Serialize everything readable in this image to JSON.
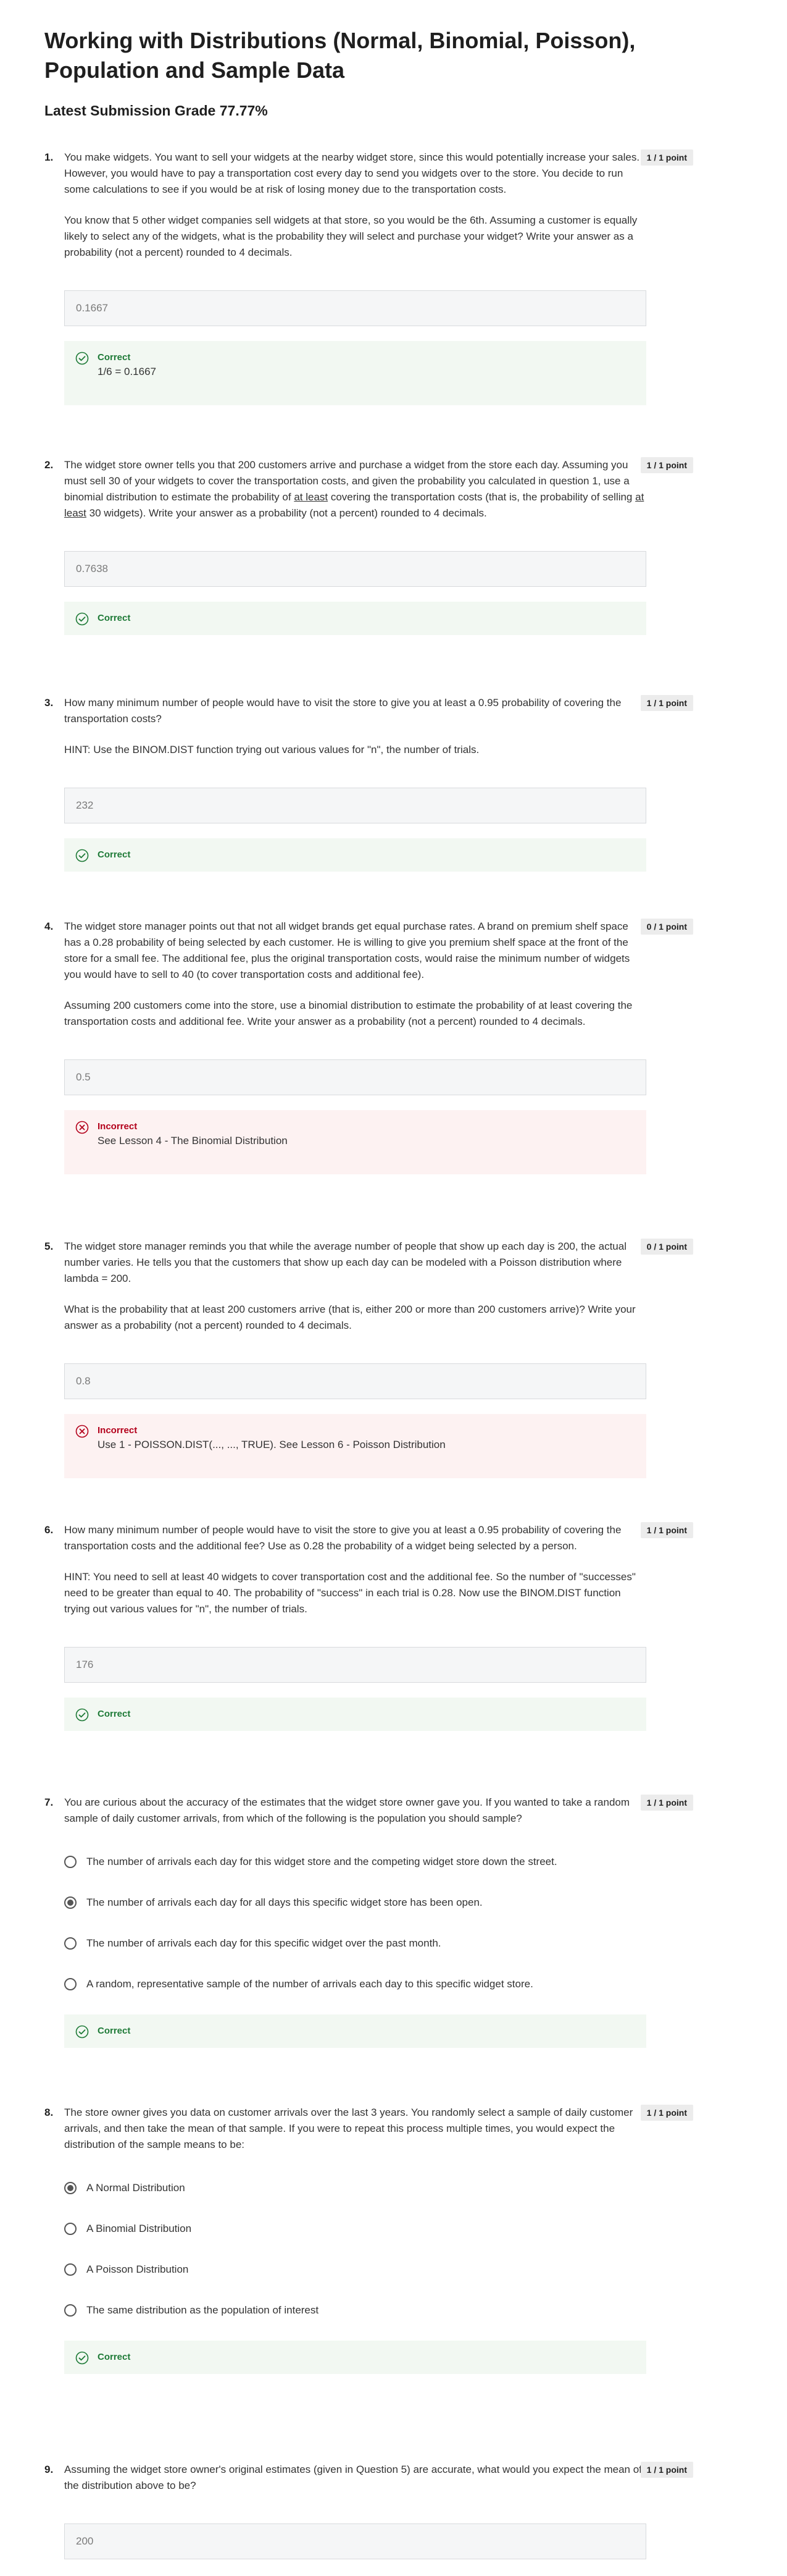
{
  "page": {
    "title": "Working with Distributions (Normal, Binomial, Poisson), Population and Sample Data",
    "grade_label": "Latest Submission Grade 77.77%"
  },
  "colors": {
    "correct": "#1e7a37",
    "incorrect": "#b3001b",
    "badge": "#ececec"
  },
  "icons": {
    "correct": "check-circle-icon",
    "incorrect": "x-circle-icon",
    "radio": "radio-button"
  },
  "questions": [
    {
      "num": "1.",
      "points": "1 / 1 point",
      "paragraphs": [
        "You make widgets.  You want to sell your widgets at the nearby widget store, since this would potentially increase your sales.  However, you would have to pay a transportation cost every day to send you widgets over to the store. You decide to run some calculations to see if you would be at risk of losing money due to the transportation costs.",
        "You know that 5 other widget companies sell widgets at that store, so you would be the 6th. Assuming a customer is equally likely to select any of the widgets, what is the probability they will select and purchase your widget? Write your answer as a probability (not a percent) rounded to 4 decimals."
      ],
      "answer": "0.1667",
      "feedback": {
        "status": "Correct",
        "explanation": "1/6 = 0.1667"
      }
    },
    {
      "num": "2.",
      "points": "1 / 1 point",
      "paragraphs": [
        "The widget store owner tells you that 200 customers arrive and purchase a widget from the store each day. Assuming you must sell 30 of your widgets to cover the transportation costs, and given the probability you calculated in question 1, use a binomial distribution to estimate the probability of at least covering the transportation costs (that is, the probability of selling at least 30 widgets). Write your answer as a probability (not a percent) rounded to 4 decimals."
      ],
      "answer": "0.7638",
      "feedback": {
        "status": "Correct",
        "explanation": ""
      }
    },
    {
      "num": "3.",
      "points": "1 / 1 point",
      "paragraphs": [
        "How many minimum number of people would have to visit the store to give you at least a 0.95 probability of covering the transportation costs?",
        "HINT: Use the BINOM.DIST function trying out various values for \"n\", the number of trials."
      ],
      "answer": "232",
      "feedback": {
        "status": "Correct",
        "explanation": ""
      }
    },
    {
      "num": "4.",
      "points": "0 / 1 point",
      "paragraphs": [
        "The widget store manager points out that not all widget brands get equal purchase rates. A brand on premium shelf space has a 0.28 probability of being selected by each customer. He is willing to give you premium shelf space at the front of the store for a small fee. The additional fee, plus the original transportation costs, would raise the minimum number of widgets you would have to sell to 40 (to cover transportation costs and additional fee).",
        "Assuming 200 customers come into the store, use a binomial distribution to estimate the probability of at least covering the transportation costs and additional fee. Write your answer as a probability (not a percent) rounded to 4 decimals."
      ],
      "answer": "0.5",
      "feedback": {
        "status": "Incorrect",
        "explanation": "See Lesson 4 - The Binomial Distribution"
      }
    },
    {
      "num": "5.",
      "points": "0 / 1 point",
      "paragraphs": [
        "The widget store manager reminds you that while the average number of people that show up each day is 200, the actual number varies. He tells you that the customers that show up each day can be modeled with a Poisson distribution where lambda = 200.",
        "What is the probability that at least 200 customers arrive (that is, either 200 or more than 200 customers arrive)? Write your answer as a probability (not a percent) rounded to 4 decimals."
      ],
      "answer": "0.8",
      "feedback": {
        "status": "Incorrect",
        "explanation": "Use 1 - POISSON.DIST(..., ..., TRUE). See Lesson 6 - Poisson Distribution"
      }
    },
    {
      "num": "6.",
      "points": "1 / 1 point",
      "paragraphs": [
        "How many minimum number of people would have to visit the store to give you at least a 0.95 probability of covering the transportation costs and the additional fee? Use as 0.28 the probability of a widget being selected by a person.",
        "HINT: You need to sell at least 40 widgets to cover transportation cost and the additional fee. So the number of \"successes\" need to be greater than equal to 40. The probability of \"success\" in each trial is 0.28. Now use the BINOM.DIST function trying out various values for \"n\", the number of trials."
      ],
      "answer": "176",
      "feedback": {
        "status": "Correct",
        "explanation": ""
      }
    },
    {
      "num": "7.",
      "points": "1 / 1 point",
      "paragraphs": [
        "You are curious about the accuracy of the estimates that the widget store owner gave you. If you wanted to take a random sample of daily customer arrivals, from which of the following is the population you should sample?"
      ],
      "options": [
        {
          "label": "The number of arrivals each day for this widget store and the competing widget store down the street.",
          "selected": false
        },
        {
          "label": "The number of arrivals each day for all days this specific widget store has been open.",
          "selected": true
        },
        {
          "label": "The number of arrivals each day for this specific widget over the past month.",
          "selected": false
        },
        {
          "label": "A random, representative sample of the number of arrivals each day to this specific widget store.",
          "selected": false
        }
      ],
      "feedback": {
        "status": "Correct",
        "explanation": ""
      }
    },
    {
      "num": "8.",
      "points": "1 / 1 point",
      "paragraphs": [
        "The store owner gives you data on customer arrivals over the last 3 years. You randomly select a sample of daily customer arrivals, and then take the mean of that sample. If you were to repeat this process multiple times, you would expect the distribution of the sample means to be:"
      ],
      "options": [
        {
          "label": "A Normal Distribution",
          "selected": true
        },
        {
          "label": "A Binomial Distribution",
          "selected": false
        },
        {
          "label": "A Poisson Distribution",
          "selected": false
        },
        {
          "label": "The same distribution as the population of interest",
          "selected": false
        }
      ],
      "feedback": {
        "status": "Correct",
        "explanation": ""
      }
    },
    {
      "num": "9.",
      "points": "1 / 1 point",
      "paragraphs": [
        "Assuming the widget store owner's original estimates (given in Question 5) are accurate, what would you expect the mean of the distribution above to be?"
      ],
      "answer": "200"
    }
  ]
}
